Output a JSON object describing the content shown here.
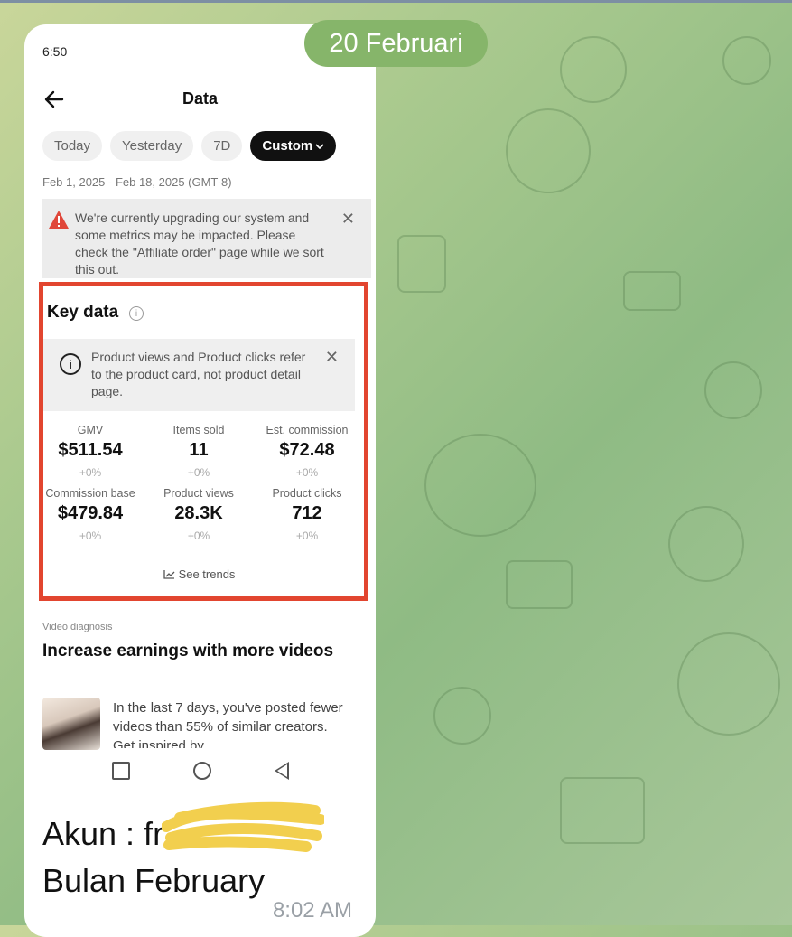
{
  "chat": {
    "date_pill": "20 Februari",
    "caption_line1": "Akun : fr",
    "caption_line2": "Bulan February",
    "message_time": "8:02 AM"
  },
  "phone": {
    "status_time": "6:50",
    "title": "Data",
    "chips": [
      "Today",
      "Yesterday",
      "7D",
      "Custom"
    ],
    "active_chip": "Custom",
    "date_range": "Feb 1, 2025 - Feb 18, 2025 (GMT-8)",
    "banner_text": "We're currently upgrading our system and some metrics may be impacted. Please check the \"Affiliate order\" page while we sort this out.",
    "key_data": {
      "title": "Key data",
      "info_glyph": "i",
      "note": "Product views and Product clicks refer to the product card, not product detail page.",
      "metrics": [
        {
          "label": "GMV",
          "value": "$511.54",
          "change": "+0%"
        },
        {
          "label": "Items sold",
          "value": "11",
          "change": "+0%"
        },
        {
          "label": "Est. commission",
          "value": "$72.48",
          "change": "+0%"
        },
        {
          "label": "Commission base",
          "value": "$479.84",
          "change": "+0%"
        },
        {
          "label": "Product views",
          "value": "28.3K",
          "change": "+0%"
        },
        {
          "label": "Product clicks",
          "value": "712",
          "change": "+0%"
        }
      ],
      "see_trends": "See trends"
    },
    "video_diagnosis": {
      "label": "Video diagnosis",
      "title": "Increase earnings with more videos",
      "text": "In the last 7 days, you've posted fewer videos than 55% of similar creators. Get inspired by"
    }
  },
  "colors": {
    "highlight_border": "#e2452f",
    "date_pill": "#86b56a",
    "active_chip": "#111111"
  }
}
